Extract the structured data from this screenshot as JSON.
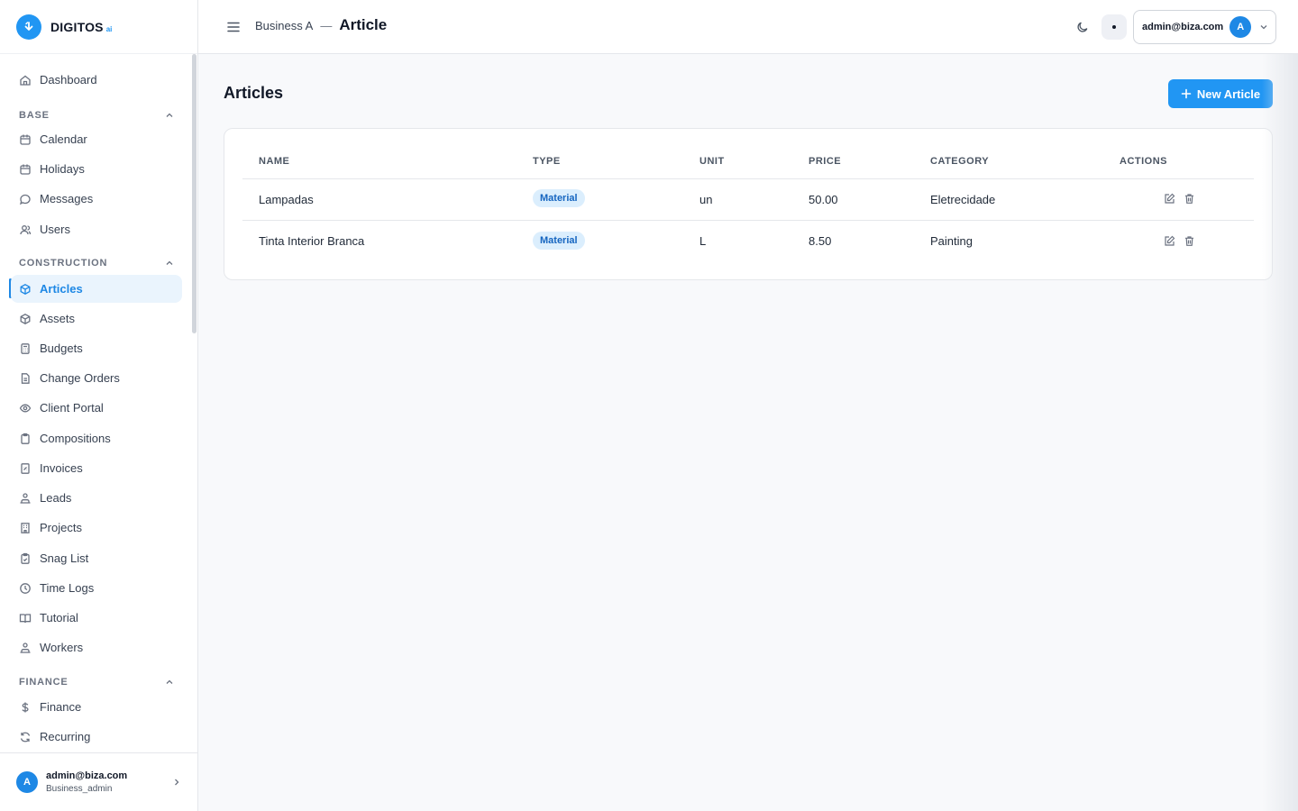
{
  "brand": {
    "name": "DIGITOS",
    "suffix": "ai"
  },
  "sidebar": {
    "dashboard": "Dashboard",
    "sections": [
      {
        "title": "BASE",
        "items": [
          "Calendar",
          "Holidays",
          "Messages",
          "Users"
        ]
      },
      {
        "title": "CONSTRUCTION",
        "items": [
          "Articles",
          "Assets",
          "Budgets",
          "Change Orders",
          "Client Portal",
          "Compositions",
          "Invoices",
          "Leads",
          "Projects",
          "Snag List",
          "Time Logs",
          "Tutorial",
          "Workers"
        ]
      },
      {
        "title": "FINANCE",
        "items": [
          "Finance",
          "Recurring"
        ]
      }
    ],
    "active_item": "Articles",
    "user": {
      "initial": "A",
      "email": "admin@biza.com",
      "role": "Business_admin"
    }
  },
  "header": {
    "business": "Business A",
    "separator": "—",
    "title": "Article",
    "account_email": "admin@biza.com",
    "account_initial": "A"
  },
  "main": {
    "title": "Articles",
    "new_button": "New Article",
    "table": {
      "columns": [
        "NAME",
        "TYPE",
        "UNIT",
        "PRICE",
        "CATEGORY",
        "ACTIONS"
      ],
      "rows": [
        {
          "name": "Lampadas",
          "type": "Material",
          "unit": "un",
          "price": "50.00",
          "category": "Eletrecidade"
        },
        {
          "name": "Tinta Interior Branca",
          "type": "Material",
          "unit": "L",
          "price": "8.50",
          "category": "Painting"
        }
      ]
    }
  },
  "colors": {
    "accent": "#2196f3",
    "active_bg": "#eaf4fd",
    "badge_bg": "#dbeefd",
    "badge_text": "#1565c0"
  }
}
